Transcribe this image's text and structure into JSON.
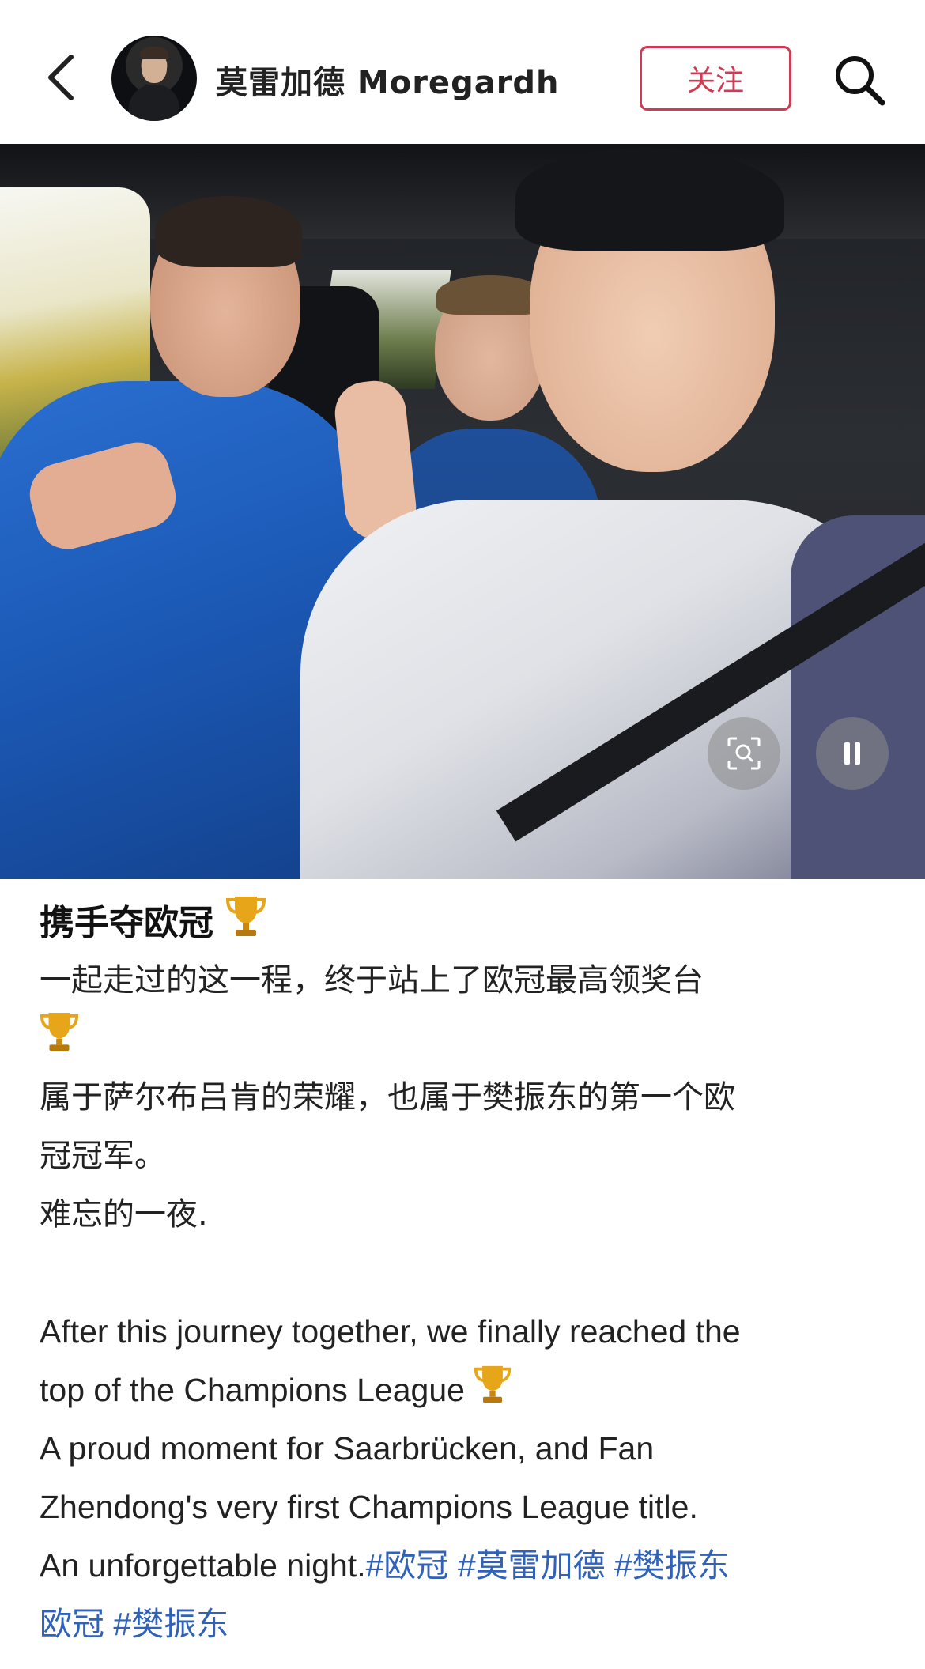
{
  "header": {
    "username": "莫雷加德 Moregardh",
    "follow_label": "关注",
    "icons": [
      "back-arrow-icon",
      "avatar",
      "search-icon"
    ]
  },
  "photo": {
    "controls": [
      "screen-scan-icon",
      "pause-icon"
    ]
  },
  "post": {
    "title": "携手夺欧冠",
    "cn_line1": "一起走过的这一程，终于站上了欧冠最高领奖台",
    "cn_line2": "属于萨尔布吕肯的荣耀，也属于樊振东的第一个欧",
    "cn_line3": "冠冠军。",
    "cn_line4": "难忘的一夜.",
    "en_line1": "After this journey together, we finally reached the",
    "en_line2": "top of the Champions League",
    "en_line3": "A proud moment for Saarbrücken, and Fan",
    "en_line4": "Zhendong's very first Champions League title.",
    "en_line5": "An unforgettable night.",
    "tags": [
      "#欧冠",
      "#莫雷加德",
      "#樊振东",
      "欧冠",
      "#樊振东"
    ],
    "accent_color": "#2f62b8"
  }
}
